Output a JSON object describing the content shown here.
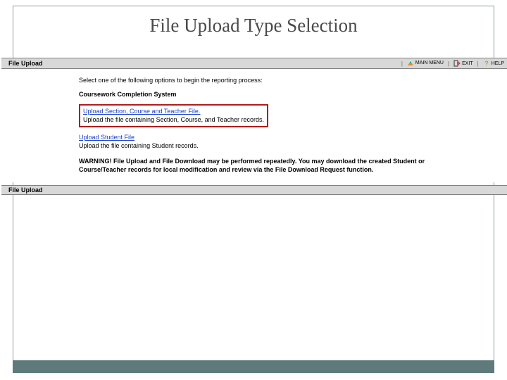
{
  "slide": {
    "title": "File Upload Type Selection"
  },
  "toolbar": {
    "title": "File Upload",
    "main_menu": "MAIN MENU",
    "exit": "EXIT",
    "help": "HELP"
  },
  "content": {
    "intro": "Select one of the following options to begin the reporting process:",
    "system_heading": "Coursework Completion System",
    "option1": {
      "link": "Upload Section, Course and Teacher File.",
      "desc": "Upload the file containing Section, Course, and Teacher records."
    },
    "option2": {
      "link": "Upload Student File",
      "desc": "Upload the file containing Student records."
    },
    "warning": "WARNING! File Upload and File Download may be performed repeatedly. You may download the created Student or Course/Teacher records for local modification and review via the File Download Request function."
  },
  "footer": {
    "title": "File Upload"
  }
}
